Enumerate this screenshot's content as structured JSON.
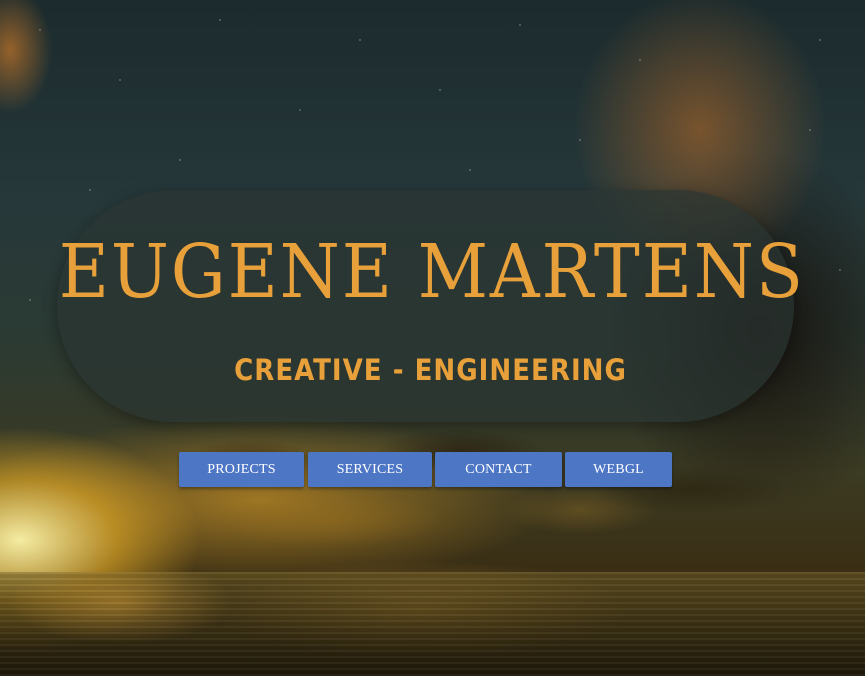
{
  "hero": {
    "title": "EUGENE MARTENS",
    "subtitle": "CREATIVE - ENGINEERING"
  },
  "nav": {
    "items": [
      {
        "label": "PROJECTS"
      },
      {
        "label": "SERVICES"
      },
      {
        "label": "CONTACT"
      },
      {
        "label": "WEBGL"
      }
    ]
  },
  "colors": {
    "accent": "#e8a03a",
    "button": "#4d76c5",
    "panel": "#2a3432"
  }
}
